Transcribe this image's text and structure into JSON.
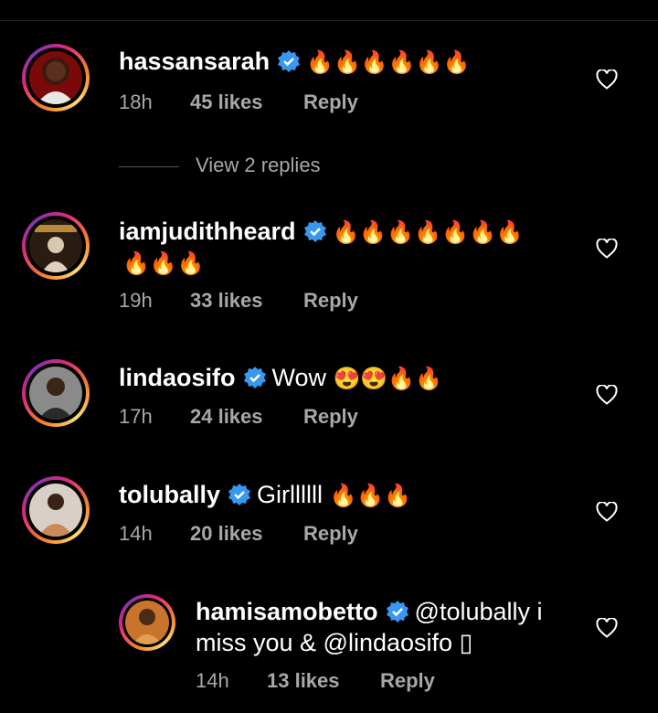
{
  "comments": [
    {
      "username": "hassansarah",
      "text": "",
      "emojis": [
        "🔥",
        "🔥",
        "🔥",
        "🔥",
        "🔥",
        "🔥"
      ],
      "time": "18h",
      "likes": "45 likes",
      "reply": "Reply",
      "view_replies": "View 2 replies"
    },
    {
      "username": "iamjudithheard",
      "text": "",
      "emojis_line1": [
        "🔥",
        "🔥",
        "🔥",
        "🔥",
        "🔥",
        "🔥",
        "🔥"
      ],
      "emojis_line2": [
        "🔥",
        "🔥",
        "🔥"
      ],
      "time": "19h",
      "likes": "33 likes",
      "reply": "Reply"
    },
    {
      "username": "lindaosifo",
      "text": "Wow",
      "emojis": [
        "😍",
        "😍",
        "🔥",
        "🔥"
      ],
      "time": "17h",
      "likes": "24 likes",
      "reply": "Reply"
    },
    {
      "username": "tolubally",
      "text": "Girllllll",
      "emojis": [
        "🔥",
        "🔥",
        "🔥"
      ],
      "time": "14h",
      "likes": "20 likes",
      "reply": "Reply"
    },
    {
      "username": "hamisamobetto",
      "text_line1": "@tolubally i",
      "text_line2": "miss you & @lindaosifo ⁠▯",
      "time": "14h",
      "likes": "13 likes",
      "reply": "Reply"
    }
  ],
  "colors": {
    "verified": "#3897f0",
    "meta": "#a8a8a8",
    "background": "#000000"
  },
  "icons": {
    "verified": "verified-badge-icon",
    "like": "heart-outline-icon"
  }
}
